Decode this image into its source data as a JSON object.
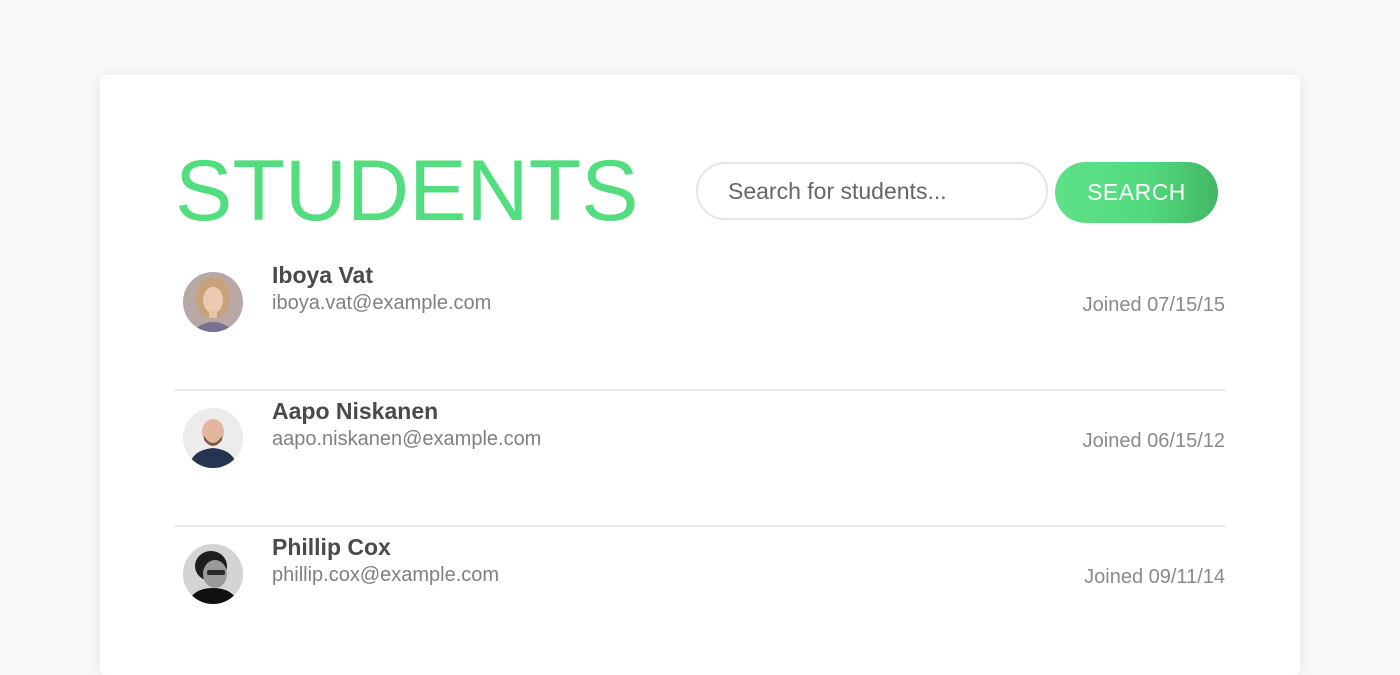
{
  "header": {
    "title": "STUDENTS"
  },
  "search": {
    "placeholder": "Search for students...",
    "value": "",
    "button_label": "SEARCH"
  },
  "colors": {
    "accent": "#52dd7f",
    "accent_dark": "#43b765",
    "text_dark": "#4a4a4a",
    "text_muted": "#808080",
    "divider": "#e8e8e8"
  },
  "students": [
    {
      "name": "Iboya Vat",
      "email": "iboya.vat@example.com",
      "joined": "Joined 07/15/15",
      "avatar": "avatar-photo"
    },
    {
      "name": "Aapo Niskanen",
      "email": "aapo.niskanen@example.com",
      "joined": "Joined 06/15/12",
      "avatar": "avatar-photo"
    },
    {
      "name": "Phillip Cox",
      "email": "phillip.cox@example.com",
      "joined": "Joined 09/11/14",
      "avatar": "avatar-photo"
    }
  ]
}
